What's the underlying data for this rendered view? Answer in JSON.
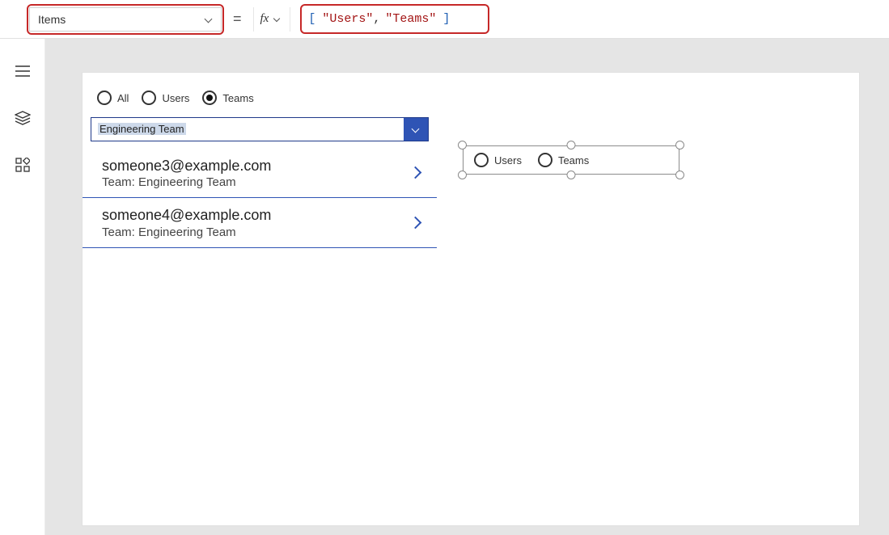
{
  "formula_bar": {
    "property": "Items",
    "formula_tokens": {
      "open": "[",
      "s1": "\"Users\"",
      "comma": ",",
      "s2": "\"Teams\"",
      "close": "]"
    }
  },
  "screen": {
    "top_radios": [
      {
        "label": "All",
        "selected": false
      },
      {
        "label": "Users",
        "selected": false
      },
      {
        "label": "Teams",
        "selected": true
      }
    ],
    "dropdown_value": "Engineering Team",
    "list": [
      {
        "primary": "someone3@example.com",
        "secondary": "Team: Engineering Team"
      },
      {
        "primary": "someone4@example.com",
        "secondary": "Team: Engineering Team"
      }
    ],
    "selected_control_radios": [
      {
        "label": "Users",
        "selected": false
      },
      {
        "label": "Teams",
        "selected": false
      }
    ]
  }
}
